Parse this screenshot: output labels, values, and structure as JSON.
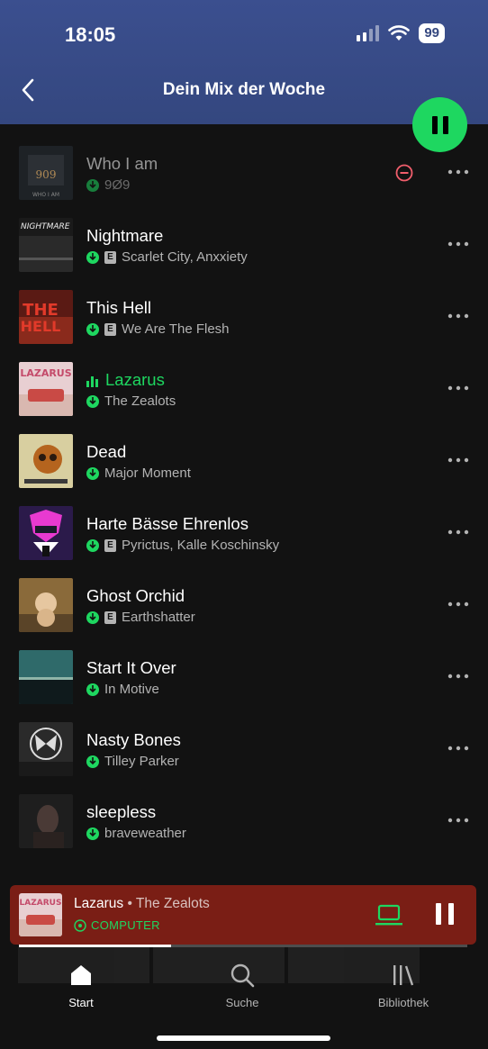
{
  "status_bar": {
    "time": "18:05",
    "battery": "99"
  },
  "header": {
    "title": "Dein Mix der Woche"
  },
  "tracks": [
    {
      "title": "Who I am",
      "artist": "9Ø9",
      "explicit": false,
      "downloaded": true,
      "playing": false,
      "unavailable": true
    },
    {
      "title": "Nightmare",
      "artist": "Scarlet City, Anxxiety",
      "explicit": true,
      "downloaded": true,
      "playing": false,
      "unavailable": false
    },
    {
      "title": "This Hell",
      "artist": "We Are The Flesh",
      "explicit": true,
      "downloaded": true,
      "playing": false,
      "unavailable": false
    },
    {
      "title": "Lazarus",
      "artist": "The Zealots",
      "explicit": false,
      "downloaded": true,
      "playing": true,
      "unavailable": false
    },
    {
      "title": "Dead",
      "artist": "Major Moment",
      "explicit": false,
      "downloaded": true,
      "playing": false,
      "unavailable": false
    },
    {
      "title": "Harte Bässe Ehrenlos",
      "artist": "Pyrictus, Kalle Koschinsky",
      "explicit": true,
      "downloaded": true,
      "playing": false,
      "unavailable": false
    },
    {
      "title": "Ghost Orchid",
      "artist": "Earthshatter",
      "explicit": true,
      "downloaded": true,
      "playing": false,
      "unavailable": false
    },
    {
      "title": "Start It Over",
      "artist": "In Motive",
      "explicit": false,
      "downloaded": true,
      "playing": false,
      "unavailable": false
    },
    {
      "title": "Nasty Bones",
      "artist": "Tilley Parker",
      "explicit": false,
      "downloaded": true,
      "playing": false,
      "unavailable": false
    },
    {
      "title": "sleepless",
      "artist": "braveweather",
      "explicit": false,
      "downloaded": true,
      "playing": false,
      "unavailable": false
    }
  ],
  "explicit_badge": "E",
  "now_playing": {
    "title": "Lazarus",
    "separator": " • ",
    "artist": "The Zealots",
    "device": "COMPUTER",
    "progress": 0.34
  },
  "bottom_nav": {
    "home": "Start",
    "search": "Suche",
    "library": "Bibliothek"
  },
  "colors": {
    "accent": "#1ed760",
    "header": "#34477f",
    "player": "#7a1e15",
    "background": "#121212"
  }
}
